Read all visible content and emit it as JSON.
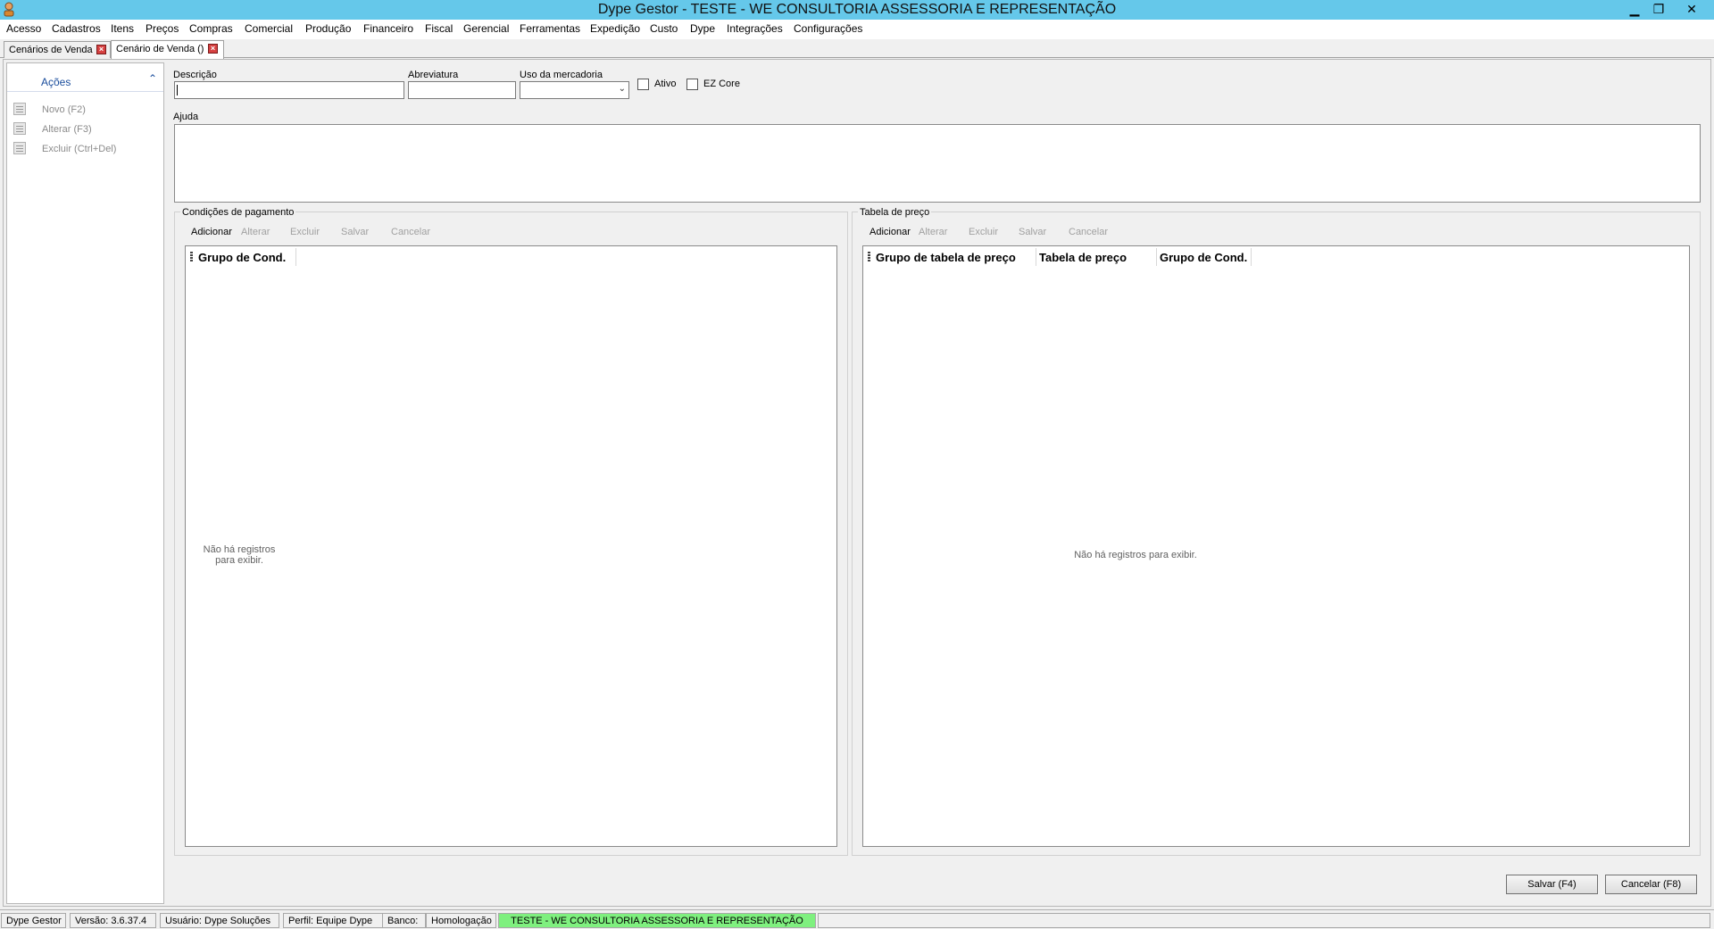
{
  "window": {
    "title": "Dype Gestor - TESTE - WE CONSULTORIA ASSESSORIA E REPRESENTAÇÃO",
    "controls": {
      "minimize": "▁",
      "restore": "❐",
      "close": "✕"
    }
  },
  "menu": [
    "Acesso",
    "Cadastros",
    "Itens",
    "Preços",
    "Compras",
    "Comercial",
    "Produção",
    "Financeiro",
    "Fiscal",
    "Gerencial",
    "Ferramentas",
    "Expedição",
    "Custo",
    "Dype",
    "Integrações",
    "Configurações"
  ],
  "tabs": [
    {
      "label": "Cenários de Venda"
    },
    {
      "label": "Cenário de Venda ()"
    }
  ],
  "sidebar": {
    "title": "Ações",
    "collapse_glyph": "⌃",
    "actions": [
      {
        "label": "Novo (F2)"
      },
      {
        "label": "Alterar (F3)"
      },
      {
        "label": "Excluir (Ctrl+Del)"
      }
    ]
  },
  "form": {
    "descricao_label": "Descrição",
    "descricao_value": "",
    "abreviatura_label": "Abreviatura",
    "abreviatura_value": "",
    "uso_label": "Uso da mercadoria",
    "uso_value": "",
    "ativo_label": "Ativo",
    "ezcore_label": "EZ Core",
    "ajuda_label": "Ajuda",
    "ajuda_value": ""
  },
  "condicoes": {
    "title": "Condições de pagamento",
    "toolbar": [
      "Adicionar",
      "Alterar",
      "Excluir",
      "Salvar",
      "Cancelar"
    ],
    "columns": [
      "Grupo de Cond."
    ],
    "empty_line1": "Não há registros",
    "empty_line2": "para exibir."
  },
  "tabela": {
    "title": "Tabela de preço",
    "toolbar": [
      "Adicionar",
      "Alterar",
      "Excluir",
      "Salvar",
      "Cancelar"
    ],
    "columns": [
      "Grupo de tabela de preço",
      "Tabela de preço",
      "Grupo de Cond."
    ],
    "empty": "Não há registros para exibir."
  },
  "footer_buttons": {
    "save": "Salvar (F4)",
    "cancel": "Cancelar (F8)"
  },
  "status": {
    "app": "Dype Gestor",
    "version": "Versão: 3.6.37.4",
    "user": "Usuário: Dype Soluções",
    "profile": "Perfil: Equipe Dype",
    "bank": "Banco:",
    "environment": "Homologação",
    "company": "TESTE - WE CONSULTORIA ASSESSORIA E REPRESENTAÇÃO"
  },
  "colors": {
    "titlebar": "#65c8ea",
    "environment_badge": "#7ff07f",
    "tab_close": "#d64040",
    "sidebar_title": "#1a4d9c"
  }
}
